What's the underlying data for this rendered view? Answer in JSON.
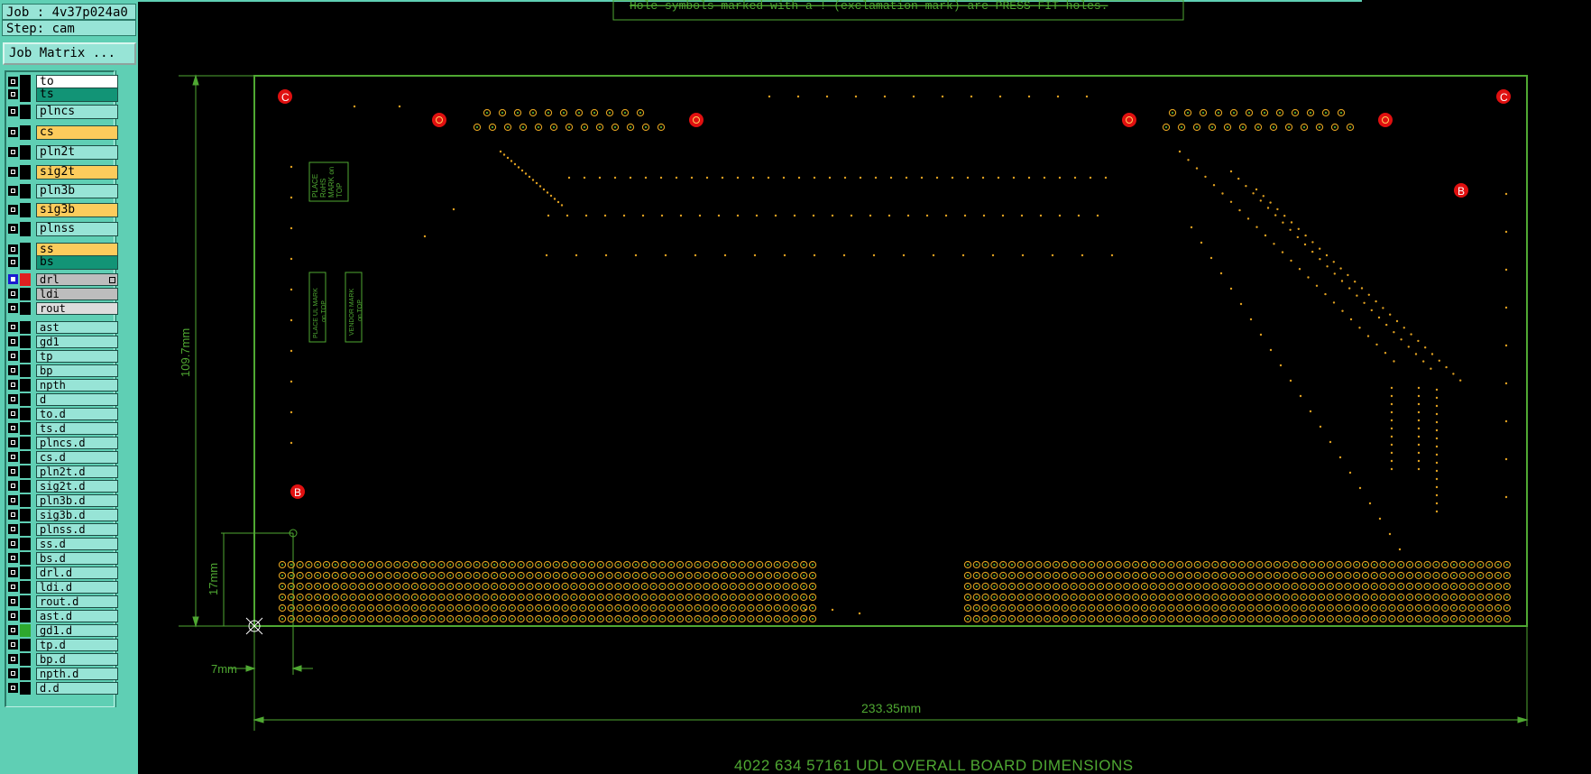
{
  "job_label": "Job : 4v37p024a0",
  "step_label": "Step: cam",
  "job_matrix_button": "Job Matrix ...",
  "layers": [
    {
      "name": "to",
      "color": "#ffffff"
    },
    {
      "name": "ts",
      "color": "#129476"
    },
    {
      "name": "plncs",
      "color": "#97e4d6"
    },
    {
      "name": "cs",
      "color": "#fccc5c"
    },
    {
      "name": "pln2t",
      "color": "#97e4d6"
    },
    {
      "name": "sig2t",
      "color": "#fccc5c"
    },
    {
      "name": "pln3b",
      "color": "#97e4d6"
    },
    {
      "name": "sig3b",
      "color": "#fccc5c"
    },
    {
      "name": "plnss",
      "color": "#97e4d6"
    },
    {
      "name": "ss",
      "color": "#fccc5c"
    },
    {
      "name": "bs",
      "color": "#129476"
    },
    {
      "name": "drl",
      "color": "#bdbdbd",
      "selected": true,
      "swatch": "#e02020"
    },
    {
      "name": "ldi",
      "color": "#bdbdbd"
    },
    {
      "name": "rout",
      "color": "#dcdcdc"
    },
    {
      "name": "ast",
      "color": "#97e4d6"
    },
    {
      "name": "gd1",
      "color": "#97e4d6"
    },
    {
      "name": "tp",
      "color": "#97e4d6"
    },
    {
      "name": "bp",
      "color": "#97e4d6"
    },
    {
      "name": "npth",
      "color": "#97e4d6"
    },
    {
      "name": "d",
      "color": "#97e4d6"
    },
    {
      "name": "to.d",
      "color": "#97e4d6"
    },
    {
      "name": "ts.d",
      "color": "#97e4d6"
    },
    {
      "name": "plncs.d",
      "color": "#97e4d6"
    },
    {
      "name": "cs.d",
      "color": "#97e4d6"
    },
    {
      "name": "pln2t.d",
      "color": "#97e4d6"
    },
    {
      "name": "sig2t.d",
      "color": "#97e4d6"
    },
    {
      "name": "pln3b.d",
      "color": "#97e4d6"
    },
    {
      "name": "sig3b.d",
      "color": "#97e4d6"
    },
    {
      "name": "plnss.d",
      "color": "#97e4d6"
    },
    {
      "name": "ss.d",
      "color": "#97e4d6"
    },
    {
      "name": "bs.d",
      "color": "#97e4d6"
    },
    {
      "name": "drl.d",
      "color": "#97e4d6"
    },
    {
      "name": "ldi.d",
      "color": "#97e4d6"
    },
    {
      "name": "rout.d",
      "color": "#97e4d6"
    },
    {
      "name": "ast.d",
      "color": "#97e4d6"
    },
    {
      "name": "gd1.d",
      "color": "#97e4d6",
      "swatch": "#2ea82e"
    },
    {
      "name": "tp.d",
      "color": "#97e4d6"
    },
    {
      "name": "bp.d",
      "color": "#97e4d6"
    },
    {
      "name": "npth.d",
      "color": "#97e4d6"
    },
    {
      "name": "d.d",
      "color": "#97e4d6"
    }
  ],
  "drawing": {
    "top_note": "Hole-symbols marked with a ! (exclamation mark) are PRESS FIT holes.",
    "dim_height": "109.7mm",
    "dim_offset_y": "17mm",
    "dim_offset_x": "7mm",
    "dim_width": "233.35mm",
    "title": "4022 634 57161   UDL OVERALL BOARD DIMENSIONS",
    "note_rohs": [
      "PLACE",
      "RoHS",
      "MARK on",
      "TOP"
    ],
    "note_ul": [
      "PLACE UL MARK",
      "on TOP"
    ],
    "note_vendor": [
      "VENDOR MARK",
      "on TOP"
    ],
    "fiducial_c": "C",
    "fiducial_b": "B",
    "colors": {
      "outline": "#4fa832",
      "pad": "#e0a020",
      "fiducial": "#e01010",
      "panel": "#5fcfb4"
    }
  }
}
